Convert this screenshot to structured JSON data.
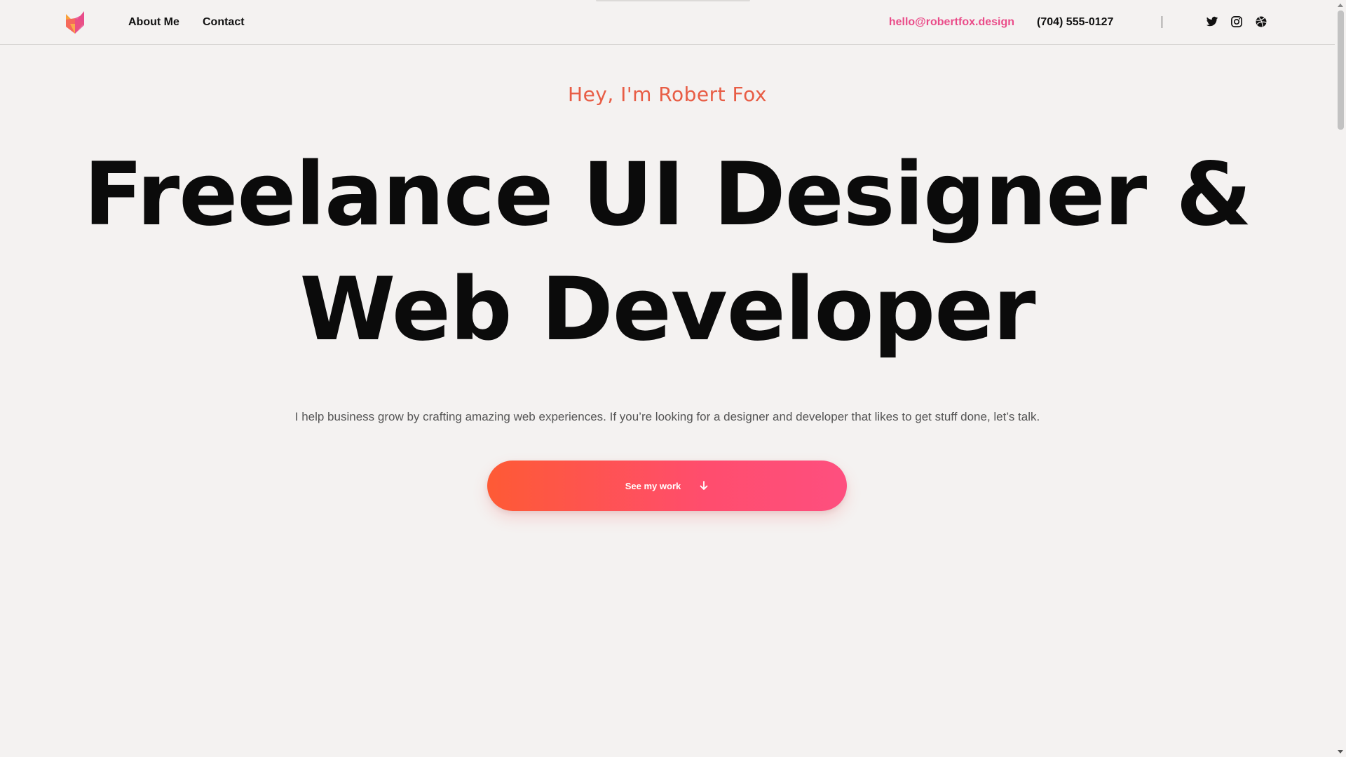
{
  "header": {
    "logo": "fox-logo",
    "nav": [
      {
        "label": "About Me"
      },
      {
        "label": "Contact"
      }
    ],
    "email": "hello@robertfox.design",
    "phone": "(704) 555-0127",
    "social_icons": [
      "twitter-icon",
      "instagram-icon",
      "dribbble-icon"
    ]
  },
  "hero": {
    "greeting": "Hey, I'm Robert Fox",
    "headline_line1": "Freelance UI Designer &",
    "headline_line2": "Web Developer",
    "intro": "I help business grow by crafting amazing web experiences. If you’re looking for a designer and developer that likes to get stuff done, let’s talk.",
    "cta_label": "See my work",
    "cta_icon": "arrow-down-icon"
  },
  "colors": {
    "background": "#f4f2f1",
    "accent_pink": "#ea4c89",
    "accent_orange": "#e85d45",
    "cta_gradient_start": "#fe5a35",
    "cta_gradient_end": "#fe4f7f",
    "text_dark": "#0b0b0b",
    "text_muted": "#555555"
  }
}
